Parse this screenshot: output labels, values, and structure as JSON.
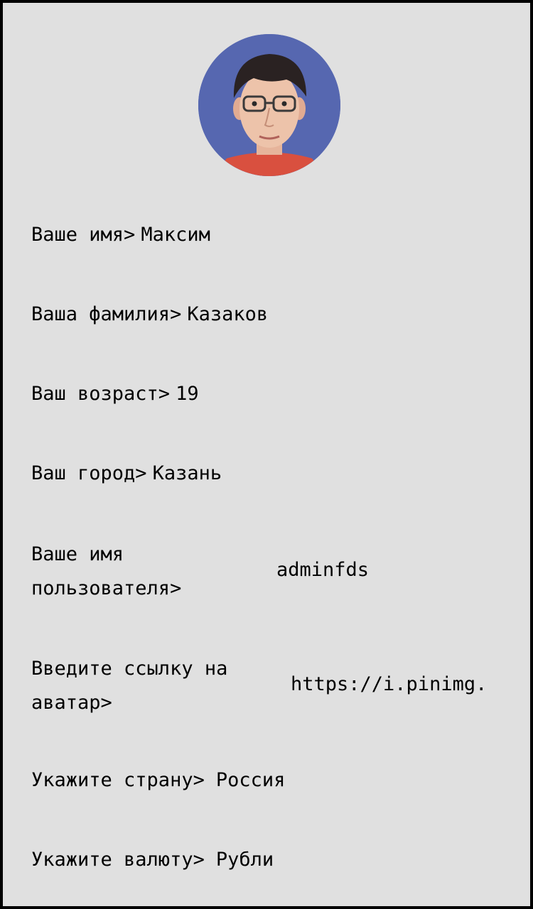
{
  "profile": {
    "avatar_alt": "avatar",
    "fields": {
      "first_name": {
        "label": "Ваше имя>",
        "value": "Максим"
      },
      "last_name": {
        "label": "Ваша фамилия>",
        "value": "Казаков"
      },
      "age": {
        "label": "Ваш возраст>",
        "value": "19"
      },
      "city": {
        "label": "Ваш город>",
        "value": "Казань"
      },
      "username": {
        "label": "Ваше имя пользователя>",
        "value": "adminfds"
      },
      "avatar_url": {
        "label": "Введите ссылку на аватар>",
        "value": "https://i.pinimg."
      },
      "country": {
        "label": "Укажите страну>",
        "value": "Россия"
      },
      "currency": {
        "label": "Укажите валюту>",
        "value": "Рубли"
      }
    }
  },
  "colors": {
    "background": "#e0e0e0",
    "frame": "#000000",
    "avatar_bg": "#5667b0"
  }
}
